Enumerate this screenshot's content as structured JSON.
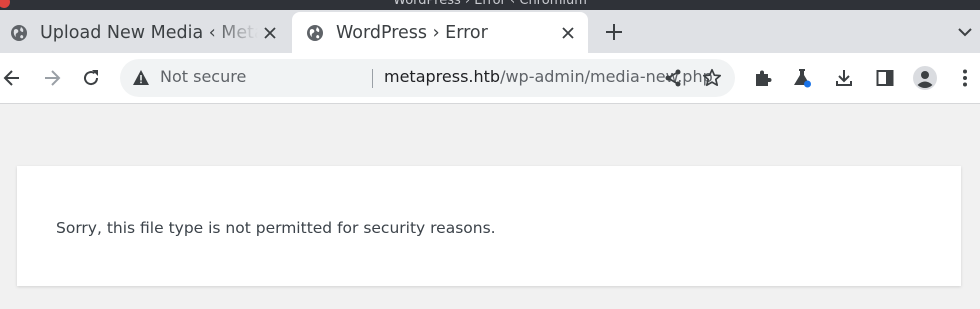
{
  "window": {
    "title": "WordPress › Error ‹ Chromium"
  },
  "tabs": [
    {
      "label": "Upload New Media ‹ Metapress",
      "favicon": "globe-icon",
      "active": false
    },
    {
      "label": "WordPress › Error",
      "favicon": "globe-icon",
      "active": true
    }
  ],
  "toolbar": {
    "security_label": "Not secure",
    "url_host": "metapress.htb",
    "url_path": "/wp-admin/media-new.php"
  },
  "page": {
    "error_message": "Sorry, this file type is not permitted for security reasons."
  },
  "colors": {
    "tabstrip": "#dfe1e5",
    "page_background": "#f1f1f1",
    "profile_dot": "#1a73e8"
  }
}
